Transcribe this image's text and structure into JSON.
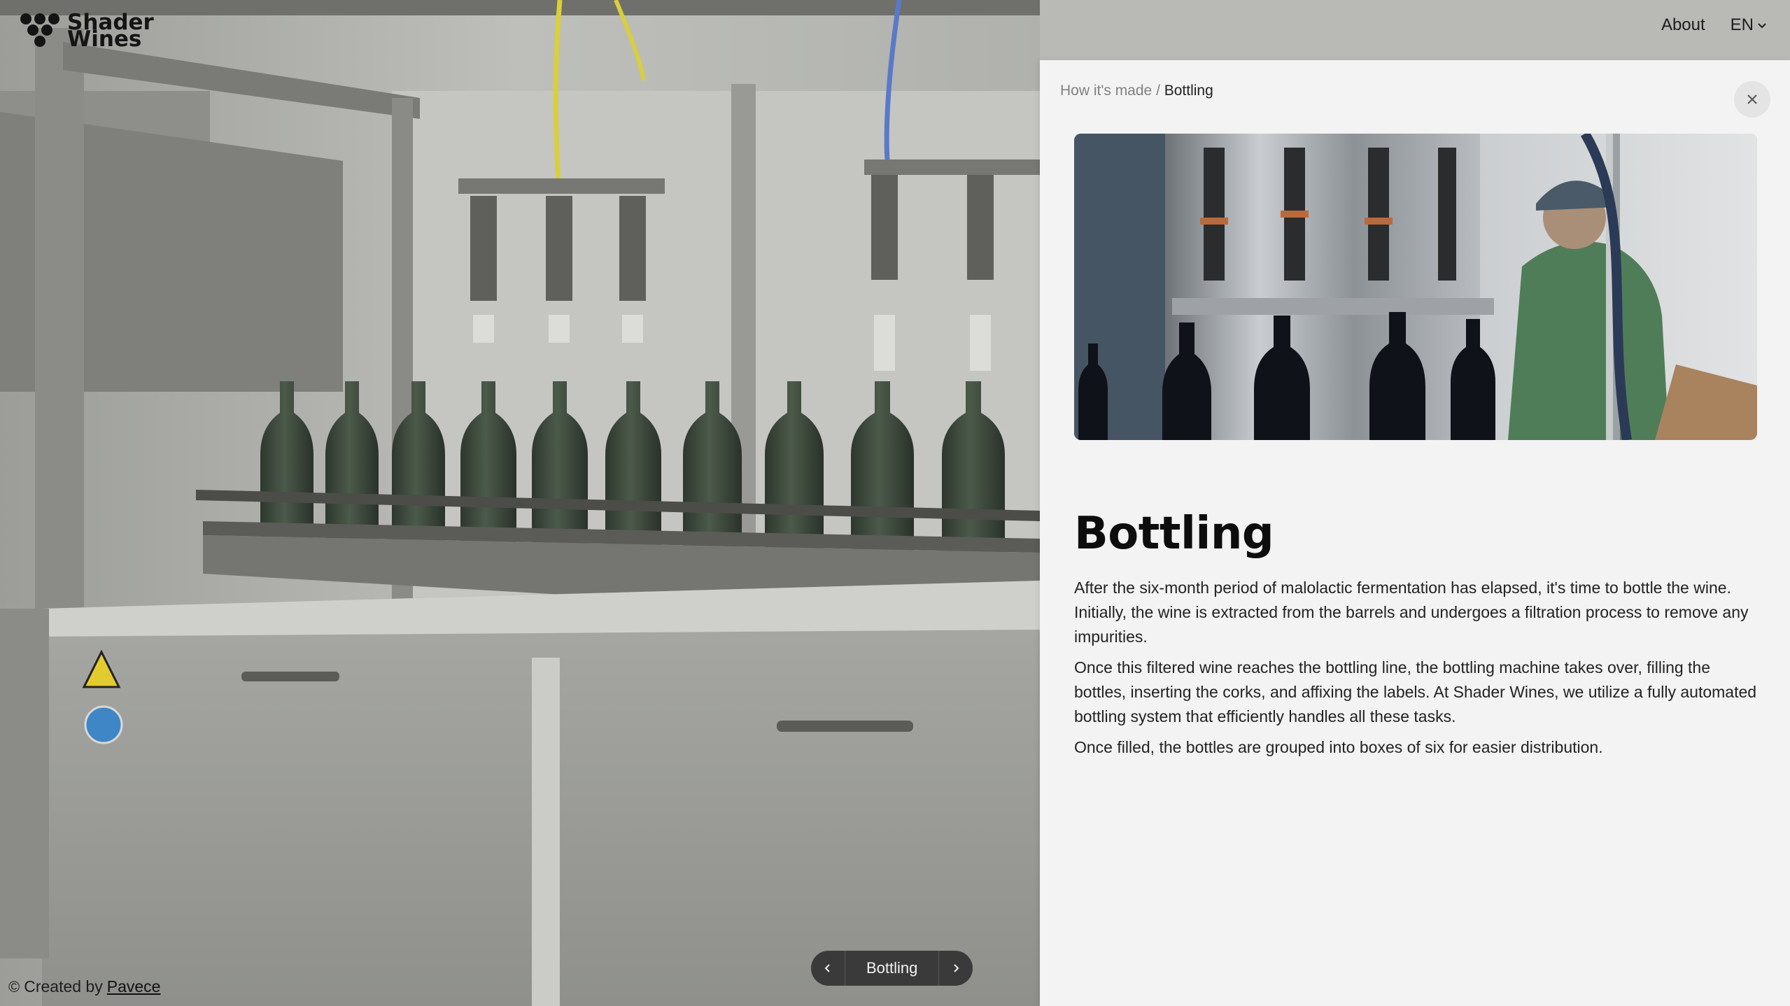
{
  "brand": {
    "line1": "Shader",
    "line2": "Wines"
  },
  "nav": {
    "about": "About",
    "language": "EN"
  },
  "panel": {
    "breadcrumb_parent": "How it's made",
    "breadcrumb_separator": " / ",
    "breadcrumb_current": "Bottling",
    "title": "Bottling",
    "paragraphs": [
      "After the six-month period of malolactic fermentation has elapsed, it's time to bottle the wine. Initially, the wine is extracted from the barrels and undergoes a filtration process to remove any impurities.",
      "Once this filtered wine reaches the bottling line, the bottling machine takes over, filling the bottles, inserting the corks, and affixing the labels. At Shader Wines, we utilize a fully automated bottling system that efficiently handles all these tasks.",
      "Once filled, the bottles are grouped into boxes of six for easier distribution."
    ]
  },
  "stage_nav": {
    "current": "Bottling"
  },
  "credit": {
    "symbol": "©",
    "prefix": "Created by",
    "link": "Pavece"
  },
  "icons": [
    "grape-logo-icon",
    "chevron-down-icon",
    "close-icon",
    "chevron-left-icon",
    "chevron-right-icon"
  ]
}
